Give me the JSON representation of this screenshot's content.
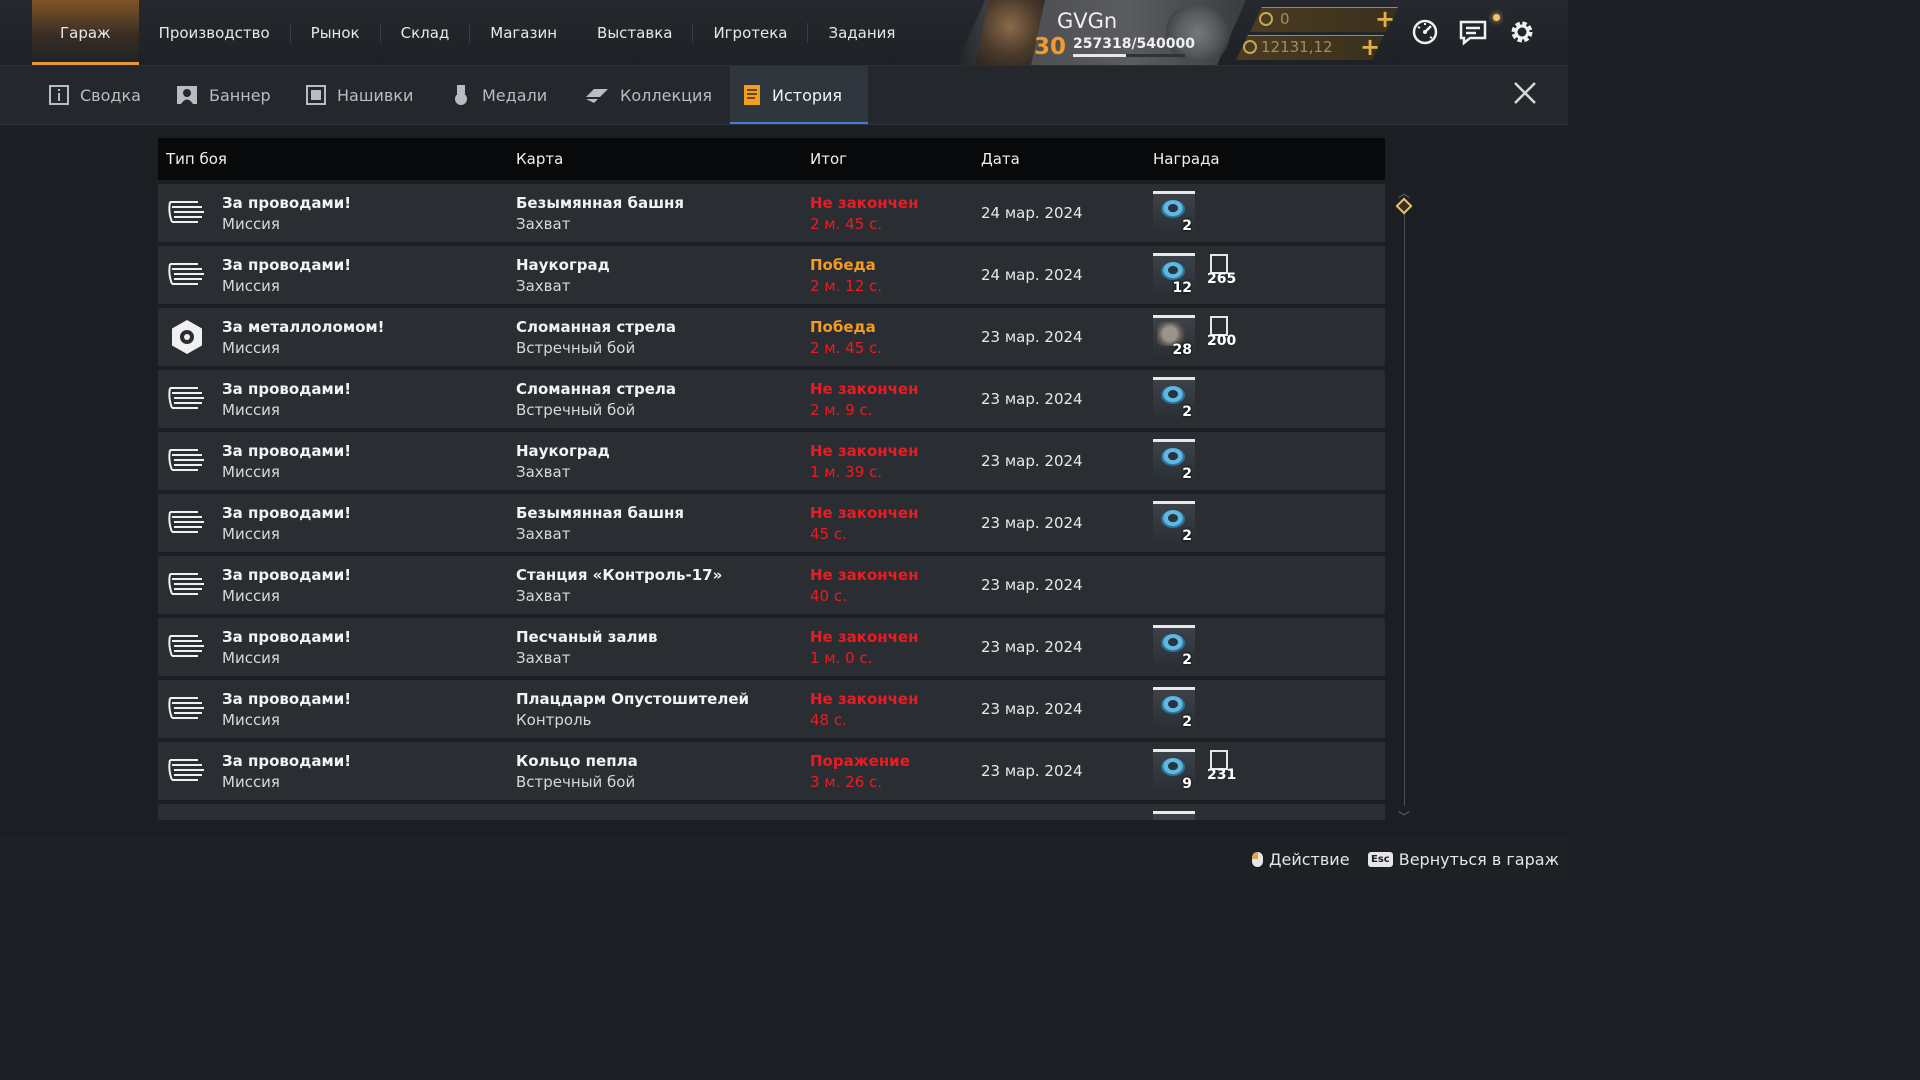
{
  "nav": {
    "items": [
      "Гараж",
      "Производство",
      "Рынок",
      "Склад",
      "Магазин",
      "Выставка",
      "Игротека",
      "Задания"
    ],
    "active": "Гараж"
  },
  "profile": {
    "nickname": "GVGn",
    "level": "30",
    "xp": "257318/540000",
    "xp_progress": 0.4765
  },
  "currency": {
    "gold": "0",
    "coins": "12131,12"
  },
  "subtabs": {
    "items": [
      "Сводка",
      "Баннер",
      "Нашивки",
      "Медали",
      "Коллекция",
      "История"
    ],
    "active": "История"
  },
  "table": {
    "headers": {
      "type": "Тип боя",
      "map": "Карта",
      "result": "Итог",
      "date": "Дата",
      "reward": "Награда"
    },
    "rows": [
      {
        "mode": "За проводами!",
        "mode_sub": "Миссия",
        "mode_icon": "wires-icon",
        "map": "Безымянная башня",
        "map_mode": "Захват",
        "result": "Не закончен",
        "result_color": "#ec1b22",
        "duration": "2 м. 45 с.",
        "date": "24 мар. 2024",
        "reward_item": "2",
        "reward_xp": ""
      },
      {
        "mode": "За проводами!",
        "mode_sub": "Миссия",
        "mode_icon": "wires-icon",
        "map": "Наукоград",
        "map_mode": "Захват",
        "result": "Победа",
        "result_color": "#f59a23",
        "duration": "2 м. 12 с.",
        "date": "24 мар. 2024",
        "reward_item": "12",
        "reward_xp": "265"
      },
      {
        "mode": "За металлоломом!",
        "mode_sub": "Миссия",
        "mode_icon": "scrap-icon",
        "map": "Сломанная стрела",
        "map_mode": "Встречный бой",
        "result": "Победа",
        "result_color": "#f59a23",
        "duration": "2 м. 45 с.",
        "date": "23 мар. 2024",
        "reward_item": "28",
        "reward_xp": "200"
      },
      {
        "mode": "За проводами!",
        "mode_sub": "Миссия",
        "mode_icon": "wires-icon",
        "map": "Сломанная стрела",
        "map_mode": "Встречный бой",
        "result": "Не закончен",
        "result_color": "#ec1b22",
        "duration": "2 м. 9 с.",
        "date": "23 мар. 2024",
        "reward_item": "2",
        "reward_xp": ""
      },
      {
        "mode": "За проводами!",
        "mode_sub": "Миссия",
        "mode_icon": "wires-icon",
        "map": "Наукоград",
        "map_mode": "Захват",
        "result": "Не закончен",
        "result_color": "#ec1b22",
        "duration": "1 м. 39 с.",
        "date": "23 мар. 2024",
        "reward_item": "2",
        "reward_xp": ""
      },
      {
        "mode": "За проводами!",
        "mode_sub": "Миссия",
        "mode_icon": "wires-icon",
        "map": "Безымянная башня",
        "map_mode": "Захват",
        "result": "Не закончен",
        "result_color": "#ec1b22",
        "duration": "45 с.",
        "date": "23 мар. 2024",
        "reward_item": "2",
        "reward_xp": ""
      },
      {
        "mode": "За проводами!",
        "mode_sub": "Миссия",
        "mode_icon": "wires-icon",
        "map": "Станция «Контроль-17»",
        "map_mode": "Захват",
        "result": "Не закончен",
        "result_color": "#ec1b22",
        "duration": "40 с.",
        "date": "23 мар. 2024",
        "reward_item": "",
        "reward_xp": ""
      },
      {
        "mode": "За проводами!",
        "mode_sub": "Миссия",
        "mode_icon": "wires-icon",
        "map": "Песчаный залив",
        "map_mode": "Захват",
        "result": "Не закончен",
        "result_color": "#ec1b22",
        "duration": "1 м. 0 с.",
        "date": "23 мар. 2024",
        "reward_item": "2",
        "reward_xp": ""
      },
      {
        "mode": "За проводами!",
        "mode_sub": "Миссия",
        "mode_icon": "wires-icon",
        "map": "Плацдарм Опустошителей",
        "map_mode": "Контроль",
        "result": "Не закончен",
        "result_color": "#ec1b22",
        "duration": "48 с.",
        "date": "23 мар. 2024",
        "reward_item": "2",
        "reward_xp": ""
      },
      {
        "mode": "За проводами!",
        "mode_sub": "Миссия",
        "mode_icon": "wires-icon",
        "map": "Кольцо пепла",
        "map_mode": "Встречный бой",
        "result": "Поражение",
        "result_color": "#ec1b22",
        "duration": "3 м. 26 с.",
        "date": "23 мар. 2024",
        "reward_item": "9",
        "reward_xp": "231"
      },
      {
        "mode": "",
        "mode_sub": "",
        "mode_icon": "wires-icon",
        "map": "",
        "map_mode": "",
        "result": "",
        "result_color": "#ec1b22",
        "duration": "",
        "date": "",
        "reward_item": "",
        "reward_xp": ""
      }
    ]
  },
  "footer": {
    "action_label": "Действие",
    "esc_key": "Esc",
    "back_label": "Вернуться в гараж"
  }
}
